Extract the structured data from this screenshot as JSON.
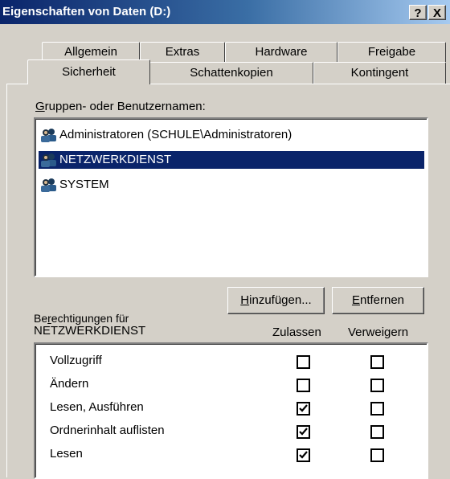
{
  "window": {
    "title": "Eigenschaften von Daten (D:)",
    "help_label": "?",
    "close_label": "X"
  },
  "tabs": {
    "row1": [
      {
        "label": "Allgemein"
      },
      {
        "label": "Extras"
      },
      {
        "label": "Hardware"
      },
      {
        "label": "Freigabe"
      }
    ],
    "row2": [
      {
        "label": "Sicherheit",
        "active": true
      },
      {
        "label": "Schattenkopien"
      },
      {
        "label": "Kontingent"
      }
    ]
  },
  "groups": {
    "label_prefix": "G",
    "label_rest": "ruppen- oder Benutzernamen:",
    "items": [
      {
        "name": "Administratoren (SCHULE\\Administratoren)",
        "icon": "users-group-icon"
      },
      {
        "name": "NETZWERKDIENST",
        "icon": "users-group-icon",
        "selected": true
      },
      {
        "name": "SYSTEM",
        "icon": "users-group-icon"
      }
    ]
  },
  "buttons": {
    "add_prefix": "H",
    "add_rest": "inzufügen...",
    "remove_prefix": "E",
    "remove_rest": "ntfernen"
  },
  "permissions": {
    "header_prefix": "Be",
    "header_underlined": "r",
    "header_rest": "echtigungen für",
    "subject": "NETZWERKDIENST",
    "allow_label": "Zulassen",
    "deny_label": "Verweigern",
    "items": [
      {
        "name": "Vollzugriff",
        "allow": false,
        "deny": false
      },
      {
        "name": "Ändern",
        "allow": false,
        "deny": false
      },
      {
        "name": "Lesen, Ausführen",
        "allow": true,
        "deny": false
      },
      {
        "name": "Ordnerinhalt auflisten",
        "allow": true,
        "deny": false
      },
      {
        "name": "Lesen",
        "allow": true,
        "deny": false
      }
    ]
  }
}
